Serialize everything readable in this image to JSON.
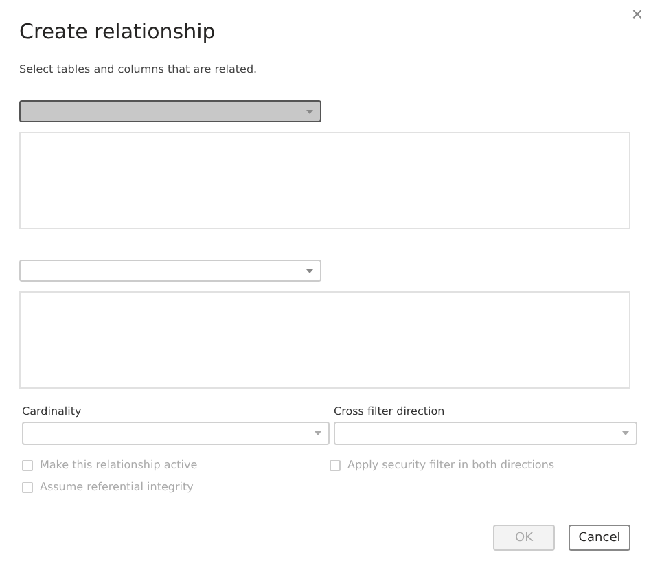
{
  "dialog": {
    "title": "Create relationship",
    "subtitle": "Select tables and columns that are related.",
    "close_glyph": "×"
  },
  "table_selectors": [
    {
      "active": true
    },
    {
      "active": false
    }
  ],
  "fields": [
    {
      "label": "Cardinality"
    },
    {
      "label": "Cross filter direction"
    }
  ],
  "option_columns": [
    [
      {
        "label": "Make this relationship active",
        "checked": false,
        "disabled": true
      },
      {
        "label": "Assume referential integrity",
        "checked": false,
        "disabled": true
      }
    ],
    [
      {
        "label": "Apply security filter in both directions",
        "checked": false,
        "disabled": true
      }
    ]
  ],
  "buttons": [
    {
      "label": "OK",
      "disabled": true
    },
    {
      "label": "Cancel",
      "disabled": false
    }
  ]
}
